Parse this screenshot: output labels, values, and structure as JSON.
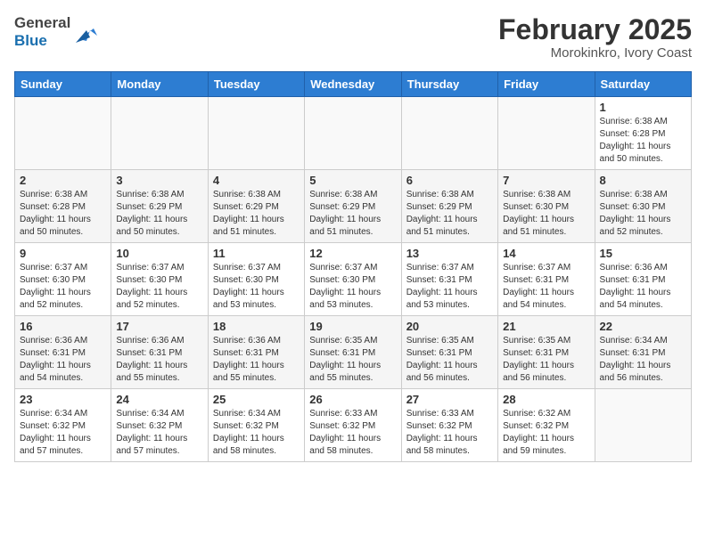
{
  "header": {
    "logo_general": "General",
    "logo_blue": "Blue",
    "month_title": "February 2025",
    "location": "Morokinkro, Ivory Coast"
  },
  "days_of_week": [
    "Sunday",
    "Monday",
    "Tuesday",
    "Wednesday",
    "Thursday",
    "Friday",
    "Saturday"
  ],
  "weeks": [
    [
      {
        "day": "",
        "info": ""
      },
      {
        "day": "",
        "info": ""
      },
      {
        "day": "",
        "info": ""
      },
      {
        "day": "",
        "info": ""
      },
      {
        "day": "",
        "info": ""
      },
      {
        "day": "",
        "info": ""
      },
      {
        "day": "1",
        "info": "Sunrise: 6:38 AM\nSunset: 6:28 PM\nDaylight: 11 hours and 50 minutes."
      }
    ],
    [
      {
        "day": "2",
        "info": "Sunrise: 6:38 AM\nSunset: 6:28 PM\nDaylight: 11 hours and 50 minutes."
      },
      {
        "day": "3",
        "info": "Sunrise: 6:38 AM\nSunset: 6:29 PM\nDaylight: 11 hours and 50 minutes."
      },
      {
        "day": "4",
        "info": "Sunrise: 6:38 AM\nSunset: 6:29 PM\nDaylight: 11 hours and 51 minutes."
      },
      {
        "day": "5",
        "info": "Sunrise: 6:38 AM\nSunset: 6:29 PM\nDaylight: 11 hours and 51 minutes."
      },
      {
        "day": "6",
        "info": "Sunrise: 6:38 AM\nSunset: 6:29 PM\nDaylight: 11 hours and 51 minutes."
      },
      {
        "day": "7",
        "info": "Sunrise: 6:38 AM\nSunset: 6:30 PM\nDaylight: 11 hours and 51 minutes."
      },
      {
        "day": "8",
        "info": "Sunrise: 6:38 AM\nSunset: 6:30 PM\nDaylight: 11 hours and 52 minutes."
      }
    ],
    [
      {
        "day": "9",
        "info": "Sunrise: 6:37 AM\nSunset: 6:30 PM\nDaylight: 11 hours and 52 minutes."
      },
      {
        "day": "10",
        "info": "Sunrise: 6:37 AM\nSunset: 6:30 PM\nDaylight: 11 hours and 52 minutes."
      },
      {
        "day": "11",
        "info": "Sunrise: 6:37 AM\nSunset: 6:30 PM\nDaylight: 11 hours and 53 minutes."
      },
      {
        "day": "12",
        "info": "Sunrise: 6:37 AM\nSunset: 6:30 PM\nDaylight: 11 hours and 53 minutes."
      },
      {
        "day": "13",
        "info": "Sunrise: 6:37 AM\nSunset: 6:31 PM\nDaylight: 11 hours and 53 minutes."
      },
      {
        "day": "14",
        "info": "Sunrise: 6:37 AM\nSunset: 6:31 PM\nDaylight: 11 hours and 54 minutes."
      },
      {
        "day": "15",
        "info": "Sunrise: 6:36 AM\nSunset: 6:31 PM\nDaylight: 11 hours and 54 minutes."
      }
    ],
    [
      {
        "day": "16",
        "info": "Sunrise: 6:36 AM\nSunset: 6:31 PM\nDaylight: 11 hours and 54 minutes."
      },
      {
        "day": "17",
        "info": "Sunrise: 6:36 AM\nSunset: 6:31 PM\nDaylight: 11 hours and 55 minutes."
      },
      {
        "day": "18",
        "info": "Sunrise: 6:36 AM\nSunset: 6:31 PM\nDaylight: 11 hours and 55 minutes."
      },
      {
        "day": "19",
        "info": "Sunrise: 6:35 AM\nSunset: 6:31 PM\nDaylight: 11 hours and 55 minutes."
      },
      {
        "day": "20",
        "info": "Sunrise: 6:35 AM\nSunset: 6:31 PM\nDaylight: 11 hours and 56 minutes."
      },
      {
        "day": "21",
        "info": "Sunrise: 6:35 AM\nSunset: 6:31 PM\nDaylight: 11 hours and 56 minutes."
      },
      {
        "day": "22",
        "info": "Sunrise: 6:34 AM\nSunset: 6:31 PM\nDaylight: 11 hours and 56 minutes."
      }
    ],
    [
      {
        "day": "23",
        "info": "Sunrise: 6:34 AM\nSunset: 6:32 PM\nDaylight: 11 hours and 57 minutes."
      },
      {
        "day": "24",
        "info": "Sunrise: 6:34 AM\nSunset: 6:32 PM\nDaylight: 11 hours and 57 minutes."
      },
      {
        "day": "25",
        "info": "Sunrise: 6:34 AM\nSunset: 6:32 PM\nDaylight: 11 hours and 58 minutes."
      },
      {
        "day": "26",
        "info": "Sunrise: 6:33 AM\nSunset: 6:32 PM\nDaylight: 11 hours and 58 minutes."
      },
      {
        "day": "27",
        "info": "Sunrise: 6:33 AM\nSunset: 6:32 PM\nDaylight: 11 hours and 58 minutes."
      },
      {
        "day": "28",
        "info": "Sunrise: 6:32 AM\nSunset: 6:32 PM\nDaylight: 11 hours and 59 minutes."
      },
      {
        "day": "",
        "info": ""
      }
    ]
  ]
}
